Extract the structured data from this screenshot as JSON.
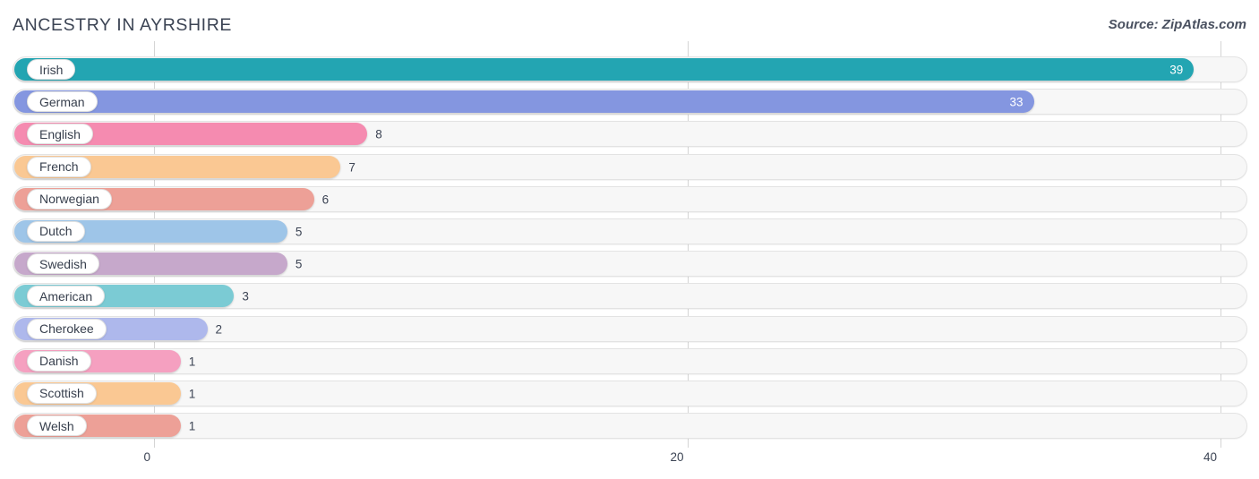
{
  "header": {
    "title": "ANCESTRY IN AYRSHIRE",
    "source": "Source: ZipAtlas.com"
  },
  "chart_data": {
    "type": "bar",
    "orientation": "horizontal",
    "title": "ANCESTRY IN AYRSHIRE",
    "xlabel": "",
    "ylabel": "",
    "xlim": [
      0,
      40
    ],
    "ticks": [
      0,
      20,
      40
    ],
    "tick_labels": [
      "0",
      "20",
      "40"
    ],
    "grid": true,
    "legend": false,
    "categories": [
      "Irish",
      "German",
      "English",
      "French",
      "Norwegian",
      "Dutch",
      "Swedish",
      "American",
      "Cherokee",
      "Danish",
      "Scottish",
      "Welsh"
    ],
    "values": [
      39,
      33,
      8,
      7,
      6,
      5,
      5,
      3,
      2,
      1,
      1,
      1
    ],
    "value_labels": [
      "39",
      "33",
      "8",
      "7",
      "6",
      "5",
      "5",
      "3",
      "2",
      "1",
      "1",
      "1"
    ],
    "colors": [
      "#23A5B2",
      "#8496E0",
      "#F58BB0",
      "#FAC893",
      "#EDA097",
      "#9EC5E8",
      "#C6A8CB",
      "#7BCBD4",
      "#AEB8EC",
      "#F5A0C0",
      "#FAC893",
      "#EDA097"
    ],
    "bars": [
      {
        "label": "Irish",
        "value": 39,
        "value_label": "39",
        "color": "#23A5B2",
        "label_inside": true
      },
      {
        "label": "German",
        "value": 33,
        "value_label": "33",
        "color": "#8496E0",
        "label_inside": true
      },
      {
        "label": "English",
        "value": 8,
        "value_label": "8",
        "color": "#F58BB0",
        "label_inside": false
      },
      {
        "label": "French",
        "value": 7,
        "value_label": "7",
        "color": "#FAC893",
        "label_inside": false
      },
      {
        "label": "Norwegian",
        "value": 6,
        "value_label": "6",
        "color": "#EDA097",
        "label_inside": false
      },
      {
        "label": "Dutch",
        "value": 5,
        "value_label": "5",
        "color": "#9EC5E8",
        "label_inside": false
      },
      {
        "label": "Swedish",
        "value": 5,
        "value_label": "5",
        "color": "#C6A8CB",
        "label_inside": false
      },
      {
        "label": "American",
        "value": 3,
        "value_label": "3",
        "color": "#7BCBD4",
        "label_inside": false
      },
      {
        "label": "Cherokee",
        "value": 2,
        "value_label": "2",
        "color": "#AEB8EC",
        "label_inside": false
      },
      {
        "label": "Danish",
        "value": 1,
        "value_label": "1",
        "color": "#F5A0C0",
        "label_inside": false
      },
      {
        "label": "Scottish",
        "value": 1,
        "value_label": "1",
        "color": "#FAC893",
        "label_inside": false
      },
      {
        "label": "Welsh",
        "value": 1,
        "value_label": "1",
        "color": "#EDA097",
        "label_inside": false
      }
    ]
  },
  "colors": {
    "background": "#ffffff",
    "track": "#f7f7f7",
    "track_border": "#e3e3e3",
    "gridline": "#d5d5d5",
    "text": "#3c4454"
  }
}
